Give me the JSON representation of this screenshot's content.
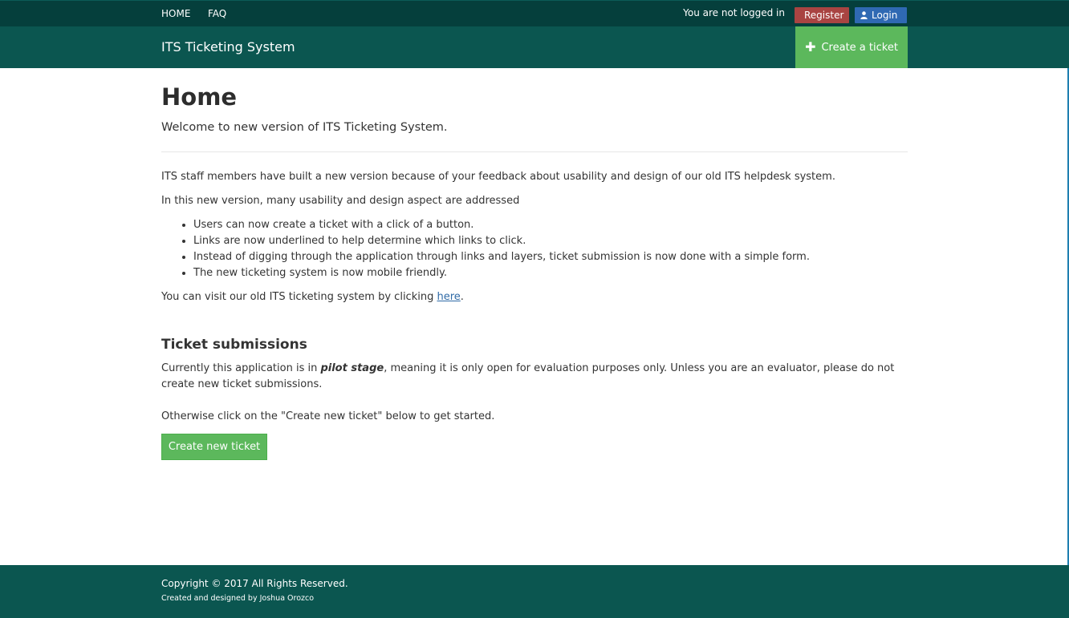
{
  "topbar": {
    "nav": [
      "HOME",
      "FAQ"
    ],
    "status": "You are not logged in",
    "register_label": "Register",
    "login_label": "Login",
    "register_color": "#a94442",
    "login_color": "#2f69b3"
  },
  "brandbar": {
    "brand": "ITS Ticketing System",
    "create_label": "Create a ticket",
    "create_icon": "plus-icon"
  },
  "main": {
    "title": "Home",
    "lead": "Welcome to new version of ITS Ticketing System.",
    "para1": "ITS staff members have built a new version because of your feedback about usability and design of our old ITS helpdesk system.",
    "para2": "In this new version, many usability and design aspect are addressed",
    "features": [
      "Users can now create a ticket with a click of a button.",
      "Links are now underlined to help determine which links to click.",
      "Instead of digging through the application through links and layers, ticket submission is now done with a simple form.",
      "The new ticketing system is now mobile friendly."
    ],
    "old_system_prefix": "You can visit our old ITS ticketing system by clicking ",
    "old_system_link": "here",
    "old_system_suffix": ".",
    "submissions_title": "Ticket submissions",
    "pilot_prefix": "Currently this application is in ",
    "pilot_emphasis": "pilot stage",
    "pilot_suffix": ", meaning it is only open for evaluation purposes only. Unless you are an evaluator, please do not create new ticket submissions.",
    "otherwise": "Otherwise click on the \"Create new ticket\" below to get started.",
    "create_button": "Create new ticket"
  },
  "footer": {
    "copyright": "Copyright © 2017 All Rights Reserved.",
    "credit": "Created and designed by Joshua Orozco"
  },
  "colors": {
    "topbar": "#053f3c",
    "brandbar": "#0b5650",
    "success": "#5cb85c",
    "link": "#2f6aa6"
  }
}
